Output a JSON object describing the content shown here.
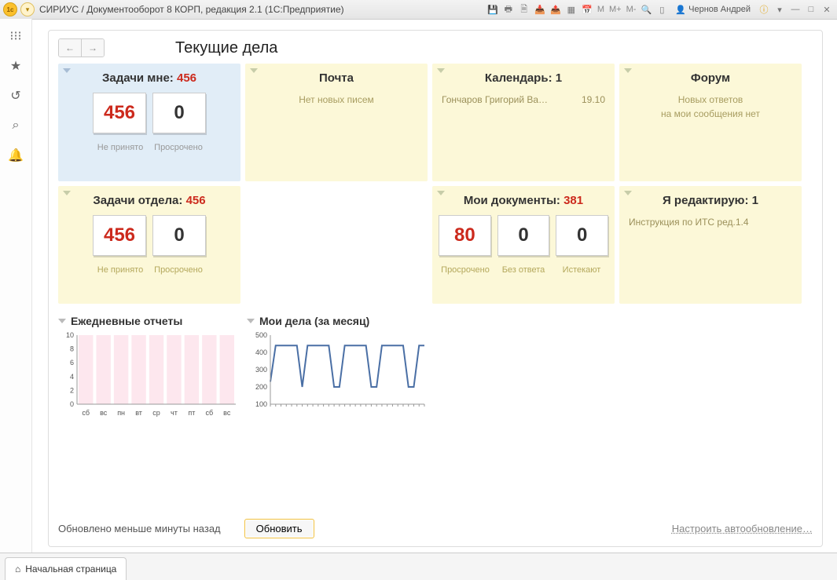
{
  "titlebar": {
    "title": "СИРИУС / Документооборот 8 КОРП, редакция 2.1  (1С:Предприятие)",
    "user": "Чернов Андрей",
    "m_labels": [
      "M",
      "M+",
      "M-"
    ]
  },
  "sidebar": {
    "icons": [
      "apps",
      "star",
      "history",
      "search",
      "bell"
    ]
  },
  "page": {
    "title": "Текущие дела"
  },
  "widgets": {
    "my_tasks": {
      "title": "Задачи мне:",
      "count": "456",
      "stats": [
        {
          "value": "456",
          "red": true
        },
        {
          "value": "0",
          "red": false
        }
      ],
      "labels": [
        "Не принято",
        "Просрочено"
      ]
    },
    "mail": {
      "title": "Почта",
      "empty_text": "Нет новых писем"
    },
    "calendar": {
      "title": "Календарь:",
      "count": "1",
      "item_name": "Гончаров Григорий Ва…",
      "item_date": "19.10"
    },
    "forum": {
      "title": "Форум",
      "line1": "Новых ответов",
      "line2": "на мои сообщения нет"
    },
    "dept_tasks": {
      "title": "Задачи отдела:",
      "count": "456",
      "stats": [
        {
          "value": "456",
          "red": true
        },
        {
          "value": "0",
          "red": false
        }
      ],
      "labels": [
        "Не принято",
        "Просрочено"
      ]
    },
    "my_docs": {
      "title": "Мои документы:",
      "count": "381",
      "stats": [
        {
          "value": "80",
          "red": true
        },
        {
          "value": "0",
          "red": false
        },
        {
          "value": "0",
          "red": false
        }
      ],
      "labels": [
        "Просрочено",
        "Без ответа",
        "Истекают"
      ]
    },
    "editing": {
      "title": "Я редактирую:",
      "count": "1",
      "item": "Инструкция по ИТС ред.1.4"
    }
  },
  "charts_title": {
    "daily": "Ежедневные отчеты",
    "monthly": "Мои дела (за месяц)"
  },
  "footer": {
    "status": "Обновлено меньше минуты назад",
    "refresh": "Обновить",
    "settings": "Настроить автообновление…"
  },
  "bottom_tab": "Начальная страница",
  "chart_data": [
    {
      "type": "bar",
      "title": "Ежедневные отчеты",
      "categories": [
        "сб",
        "вс",
        "пн",
        "вт",
        "ср",
        "чт",
        "пт",
        "сб",
        "вс"
      ],
      "values": [
        0,
        0,
        0,
        0,
        0,
        0,
        0,
        0,
        0
      ],
      "ylim": [
        0,
        10
      ],
      "yticks": [
        0,
        2,
        4,
        6,
        8,
        10
      ]
    },
    {
      "type": "line",
      "title": "Мои дела (за месяц)",
      "x": [
        1,
        2,
        3,
        4,
        5,
        6,
        7,
        8,
        9,
        10,
        11,
        12,
        13,
        14,
        15,
        16,
        17,
        18,
        19,
        20,
        21,
        22,
        23,
        24,
        25,
        26,
        27,
        28,
        29,
        30
      ],
      "values": [
        230,
        440,
        440,
        440,
        440,
        440,
        200,
        440,
        440,
        440,
        440,
        440,
        200,
        200,
        440,
        440,
        440,
        440,
        440,
        200,
        200,
        440,
        440,
        440,
        440,
        440,
        200,
        200,
        440,
        440
      ],
      "ylim": [
        100,
        500
      ],
      "yticks": [
        100,
        200,
        300,
        400,
        500
      ]
    }
  ]
}
